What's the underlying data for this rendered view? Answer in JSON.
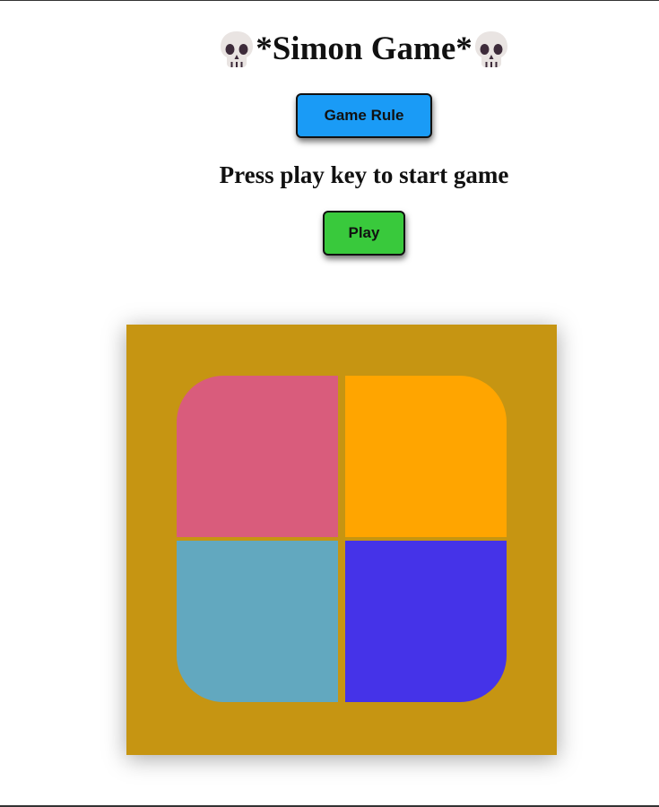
{
  "header": {
    "title": "*Simon Game*",
    "title_icon": "skull-icon"
  },
  "controls": {
    "rules_label": "Game Rule",
    "play_label": "Play",
    "status_text": "Press play key to start game"
  },
  "colors": {
    "rules_button": "#1a9bf6",
    "play_button": "#39c93c",
    "board": "#c69512",
    "pad_red": "#d95c7c",
    "pad_yellow": "#ffa500",
    "pad_green": "#62a8bf",
    "pad_purple": "#4533e8"
  },
  "board": {
    "pads": [
      {
        "id": "red"
      },
      {
        "id": "yellow"
      },
      {
        "id": "green"
      },
      {
        "id": "purple"
      }
    ]
  }
}
